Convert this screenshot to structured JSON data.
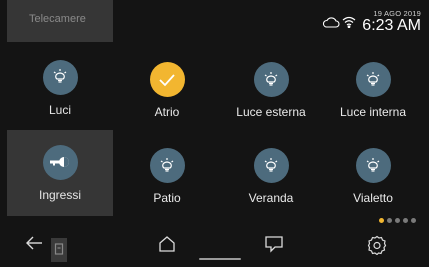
{
  "sidebar": {
    "top_label": "Telecamere",
    "items": [
      {
        "label": "Luci",
        "icon": "bulb-icon"
      },
      {
        "label": "Ingressi",
        "icon": "key-icon"
      }
    ]
  },
  "status": {
    "date": "19 AGO 2019",
    "time": "6:23 AM",
    "icons": [
      "cloud-icon",
      "wifi-icon"
    ]
  },
  "tiles": [
    {
      "label": "Atrio",
      "state": "active",
      "icon": "check-icon"
    },
    {
      "label": "Luce esterna",
      "state": "off",
      "icon": "bulb-icon"
    },
    {
      "label": "Luce interna",
      "state": "off",
      "icon": "bulb-icon"
    },
    {
      "label": "Patio",
      "state": "off",
      "icon": "bulb-icon"
    },
    {
      "label": "Veranda",
      "state": "off",
      "icon": "bulb-icon"
    },
    {
      "label": "Vialetto",
      "state": "off",
      "icon": "bulb-icon"
    }
  ],
  "pagination": {
    "total": 5,
    "current": 1
  },
  "navbar": [
    "back-icon",
    "home-icon",
    "chat-icon",
    "settings-icon"
  ],
  "colors": {
    "accent": "#f2b630",
    "icon_bg": "#4d6b7d",
    "panel": "#363636",
    "background": "#141414"
  }
}
